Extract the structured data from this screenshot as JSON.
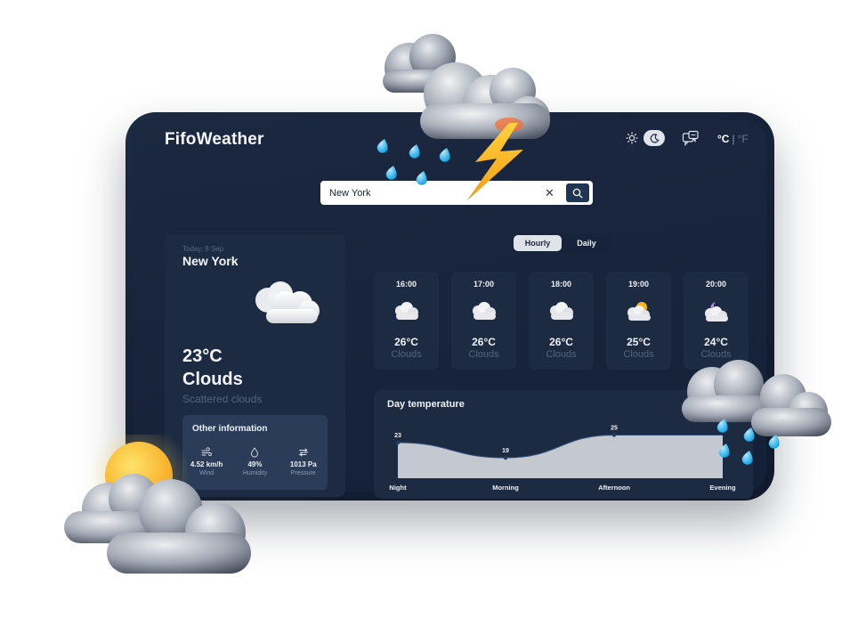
{
  "app": {
    "title": "FifoWeather"
  },
  "units": {
    "celsius": "°C",
    "separator": "|",
    "fahrenheit": "°F"
  },
  "search": {
    "value": "New York",
    "clear": "✕"
  },
  "current": {
    "date": "Today, 8 Sep",
    "city": "New York",
    "temperature": "23°C",
    "condition": "Clouds",
    "description": "Scattered clouds"
  },
  "other_info": {
    "title": "Other information",
    "items": [
      {
        "icon": "wind-icon",
        "value": "4.52 km/h",
        "label": "Wind"
      },
      {
        "icon": "humidity-icon",
        "value": "49%",
        "label": "Humidity"
      },
      {
        "icon": "pressure-icon",
        "value": "1013 Pa",
        "label": "Pressure"
      }
    ]
  },
  "tabs": {
    "hourly": "Hourly",
    "daily": "Daily",
    "active": "Hourly"
  },
  "hourly": [
    {
      "time": "16:00",
      "temp": "26°C",
      "cond": "Clouds",
      "icon": "cloud-icon"
    },
    {
      "time": "17:00",
      "temp": "26°C",
      "cond": "Clouds",
      "icon": "cloud-icon"
    },
    {
      "time": "18:00",
      "temp": "26°C",
      "cond": "Clouds",
      "icon": "cloud-icon"
    },
    {
      "time": "19:00",
      "temp": "25°C",
      "cond": "Clouds",
      "icon": "sun-cloud-icon"
    },
    {
      "time": "20:00",
      "temp": "24°C",
      "cond": "Clouds",
      "icon": "moon-cloud-icon"
    }
  ],
  "day_temperature": {
    "title": "Day temperature",
    "chart_data": {
      "type": "area",
      "title": "Day temperature",
      "categories": [
        "Night",
        "Morning",
        "Afternoon",
        "Evening"
      ],
      "values": [
        23,
        19,
        25,
        null
      ],
      "data_labels": [
        "23",
        "19",
        "25"
      ],
      "ylim": [
        15,
        27
      ],
      "grid": false,
      "colors": {
        "fill": "#c4c8cf",
        "line": "#33507a",
        "point": "#243c60"
      }
    }
  },
  "colors": {
    "background": "#ffffff",
    "app_bg": "#18253b",
    "card": "#1d2b42",
    "accent": "#1f3552",
    "lightning": "#f7a81b",
    "rain": "#2fb5ea"
  }
}
